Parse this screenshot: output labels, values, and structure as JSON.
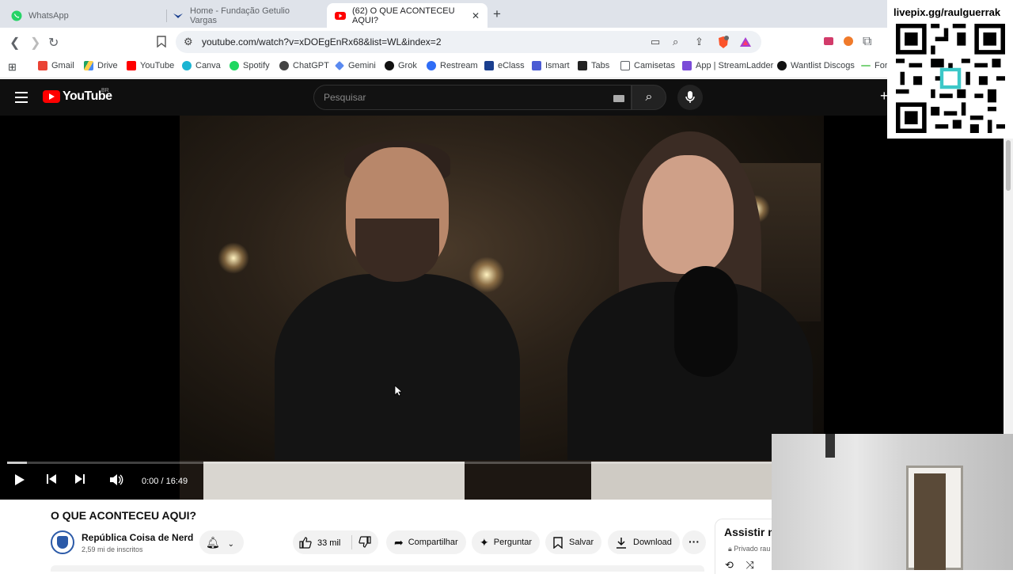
{
  "browser": {
    "tabs": [
      {
        "title": "WhatsApp",
        "active": false
      },
      {
        "title": "Home - Fundação Getulio Vargas",
        "active": false
      },
      {
        "title": "(62) O QUE ACONTECEU AQUI?",
        "active": true
      }
    ],
    "url": "youtube.com/watch?v=xDOEgEnRx68&list=WL&index=2",
    "bookmarks": [
      "Gmail",
      "Drive",
      "YouTube",
      "Canva",
      "Spotify",
      "ChatGPT",
      "Gemini",
      "Grok",
      "Restream",
      "eClass",
      "Ismart",
      "Tabs",
      "Camisetas",
      "App | StreamLadder",
      "Wantlist Discogs",
      "For"
    ]
  },
  "youtube": {
    "logo_text": "YouTube",
    "region": "BR",
    "search_placeholder": "Pesquisar"
  },
  "player": {
    "time": "0:00 / 16:49",
    "progress": 0.02
  },
  "video": {
    "title": "O QUE ACONTECEU AQUI?",
    "channel": "República Coisa de Nerd",
    "subscribers": "2,59 mi de inscritos",
    "likes": "33 mil",
    "share_label": "Compartilhar",
    "ask_label": "Perguntar",
    "save_label": "Salvar",
    "download_label": "Download"
  },
  "playlist": {
    "title": "Assistir m",
    "privacy": "Privado rau"
  },
  "overlay": {
    "livepix": "livepix.gg/raulguerrak"
  },
  "colors": {
    "youtube_red": "#ff0000",
    "header_bg": "#0f0f0f",
    "pill_bg": "#f2f2f2"
  }
}
